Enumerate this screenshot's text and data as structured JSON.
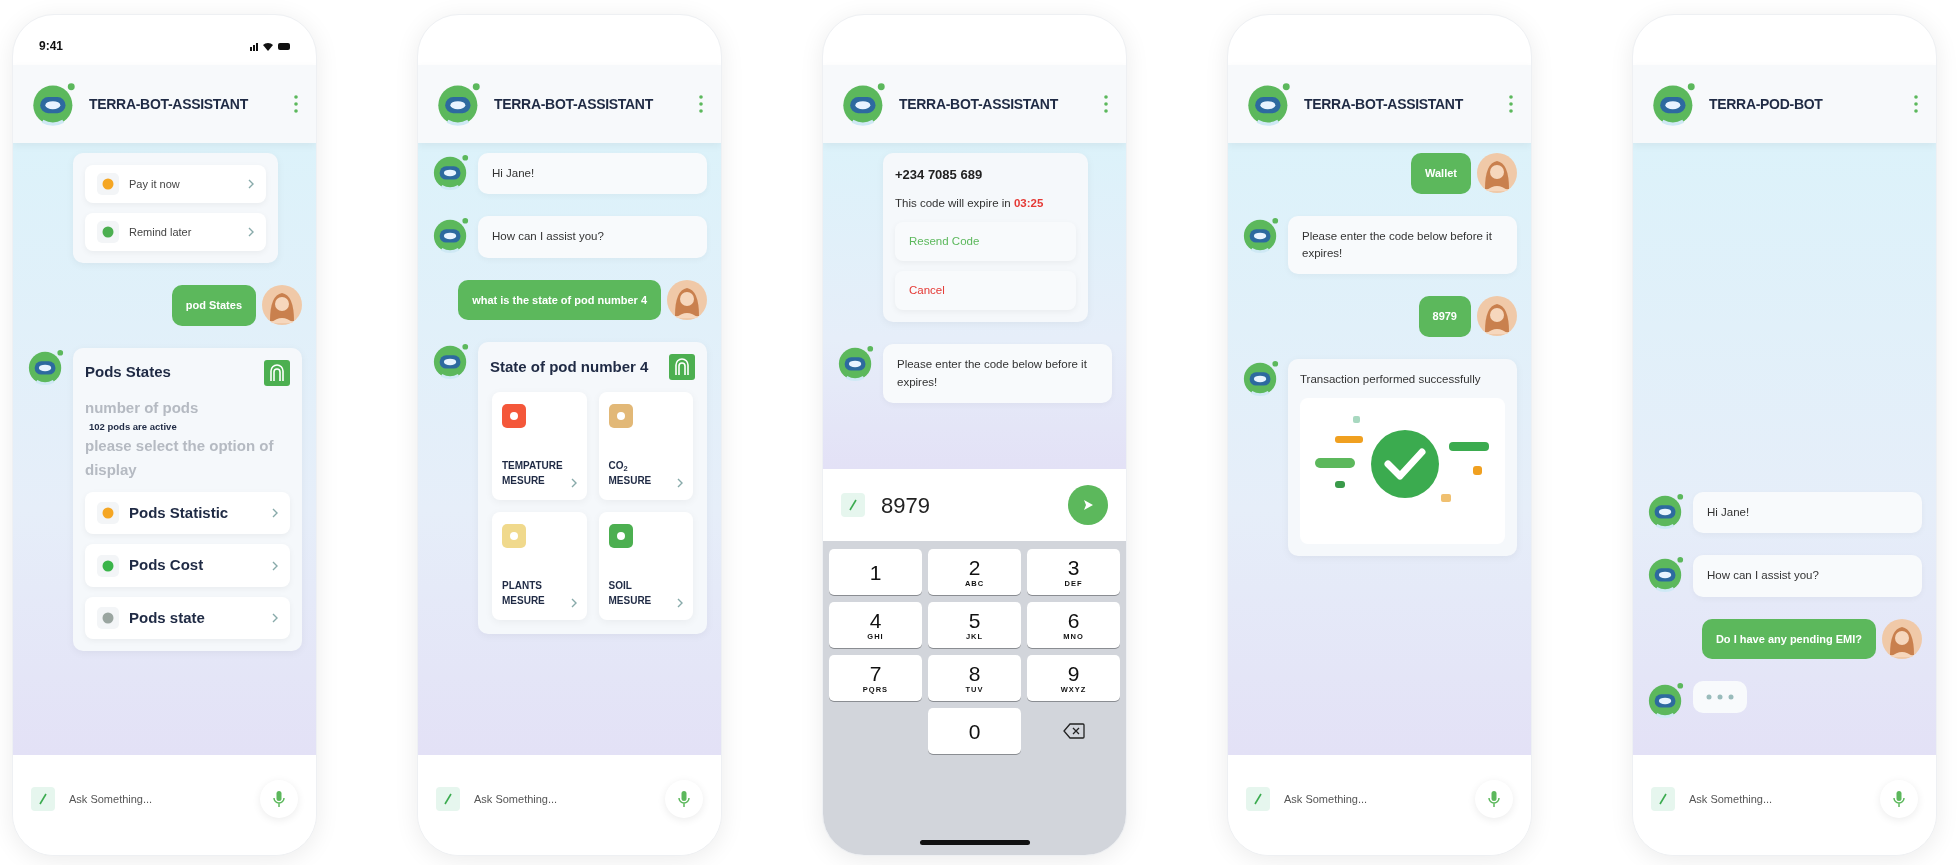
{
  "phones": [
    {
      "status_bar": {
        "time": "9:41"
      },
      "header": {
        "title": "TERRA-BOT-ASSISTANT"
      },
      "messages": [
        {
          "kind": "options",
          "options": [
            {
              "label": "Pay it now",
              "color": "#f5a623"
            },
            {
              "label": "Remind later",
              "color": "#4caf50"
            }
          ]
        },
        {
          "kind": "user",
          "text": "pod States"
        },
        {
          "kind": "pods",
          "title": "Pods States",
          "lines": [
            {
              "kind": "prompt",
              "text": "number of pods"
            },
            {
              "kind": "info",
              "text": "102 pods are active"
            },
            {
              "kind": "prompt",
              "text": "please select the option of display"
            }
          ],
          "options": [
            {
              "label": "Pods Statistic",
              "color": "#f5a623"
            },
            {
              "label": "Pods Cost",
              "color": "#3bb54a"
            },
            {
              "label": "Pods state",
              "color": "#9aa5a0"
            }
          ]
        }
      ],
      "composer": {
        "kind": "chat",
        "placeholder": "Ask Something..."
      }
    },
    {
      "header": {
        "title": "TERRA-BOT-ASSISTANT"
      },
      "messages": [
        {
          "kind": "bot",
          "text": "Hi Jane!"
        },
        {
          "kind": "bot",
          "text": "How can I assist you?"
        },
        {
          "kind": "user",
          "text": "what is the state of pod number 4"
        },
        {
          "kind": "grid",
          "title": "State of pod number 4",
          "tiles": [
            {
              "label": "TEMPATURE MESURE",
              "color": "#f4573a"
            },
            {
              "label": "CO$_{2}$ MESURE",
              "color": "#e2b877"
            },
            {
              "label": "PLANTS MESURE",
              "color": "#f0d98c"
            },
            {
              "label": "SOIL MESURE",
              "color": "#4caf50"
            }
          ]
        }
      ],
      "composer": {
        "kind": "chat",
        "placeholder": "Ask Something..."
      }
    },
    {
      "header": {
        "title": "TERRA-BOT-ASSISTANT"
      },
      "messages": [
        {
          "kind": "code",
          "phone": "+234 7085 689",
          "text": "This code will expire in **03:25**",
          "actions": [
            {
              "label": "Resend Code",
              "color": "#5cb85c"
            },
            {
              "label": "Cancel",
              "color": "#e53935"
            }
          ]
        },
        {
          "kind": "bot",
          "text": "Please enter the code below before it expires!"
        }
      ],
      "composer": {
        "kind": "code",
        "value": "8979"
      },
      "keypad": [
        {
          "kind": "digit",
          "digit": "1"
        },
        {
          "kind": "digit",
          "digit": "2",
          "letters": "ABC"
        },
        {
          "kind": "digit",
          "digit": "3",
          "letters": "DEF"
        },
        {
          "kind": "digit",
          "digit": "4",
          "letters": "GHI"
        },
        {
          "kind": "digit",
          "digit": "5",
          "letters": "JKL"
        },
        {
          "kind": "digit",
          "digit": "6",
          "letters": "MNO"
        },
        {
          "kind": "digit",
          "digit": "7",
          "letters": "PQRS"
        },
        {
          "kind": "digit",
          "digit": "8",
          "letters": "TUV"
        },
        {
          "kind": "digit",
          "digit": "9",
          "letters": "WXYZ"
        },
        {
          "kind": "blank"
        },
        {
          "kind": "digit",
          "digit": "0"
        },
        {
          "kind": "delete"
        }
      ]
    },
    {
      "header": {
        "title": "TERRA-BOT-ASSISTANT"
      },
      "messages": [
        {
          "kind": "user",
          "text": "Wallet"
        },
        {
          "kind": "bot",
          "text": "Please enter the code below before it expires!"
        },
        {
          "kind": "user",
          "text": "8979"
        },
        {
          "kind": "success",
          "text": "Transaction performed successfully"
        }
      ],
      "composer": {
        "kind": "chat",
        "placeholder": "Ask Something..."
      }
    },
    {
      "header": {
        "title": "TERRA-POD-BOT"
      },
      "messages": [
        {
          "kind": "bot",
          "text": "Hi Jane!"
        },
        {
          "kind": "bot",
          "text": "How can I assist you?"
        },
        {
          "kind": "user",
          "text": "Do I have any pending EMI?"
        },
        {
          "kind": "typing"
        }
      ],
      "composer": {
        "kind": "chat",
        "placeholder": "Ask Something..."
      }
    }
  ]
}
